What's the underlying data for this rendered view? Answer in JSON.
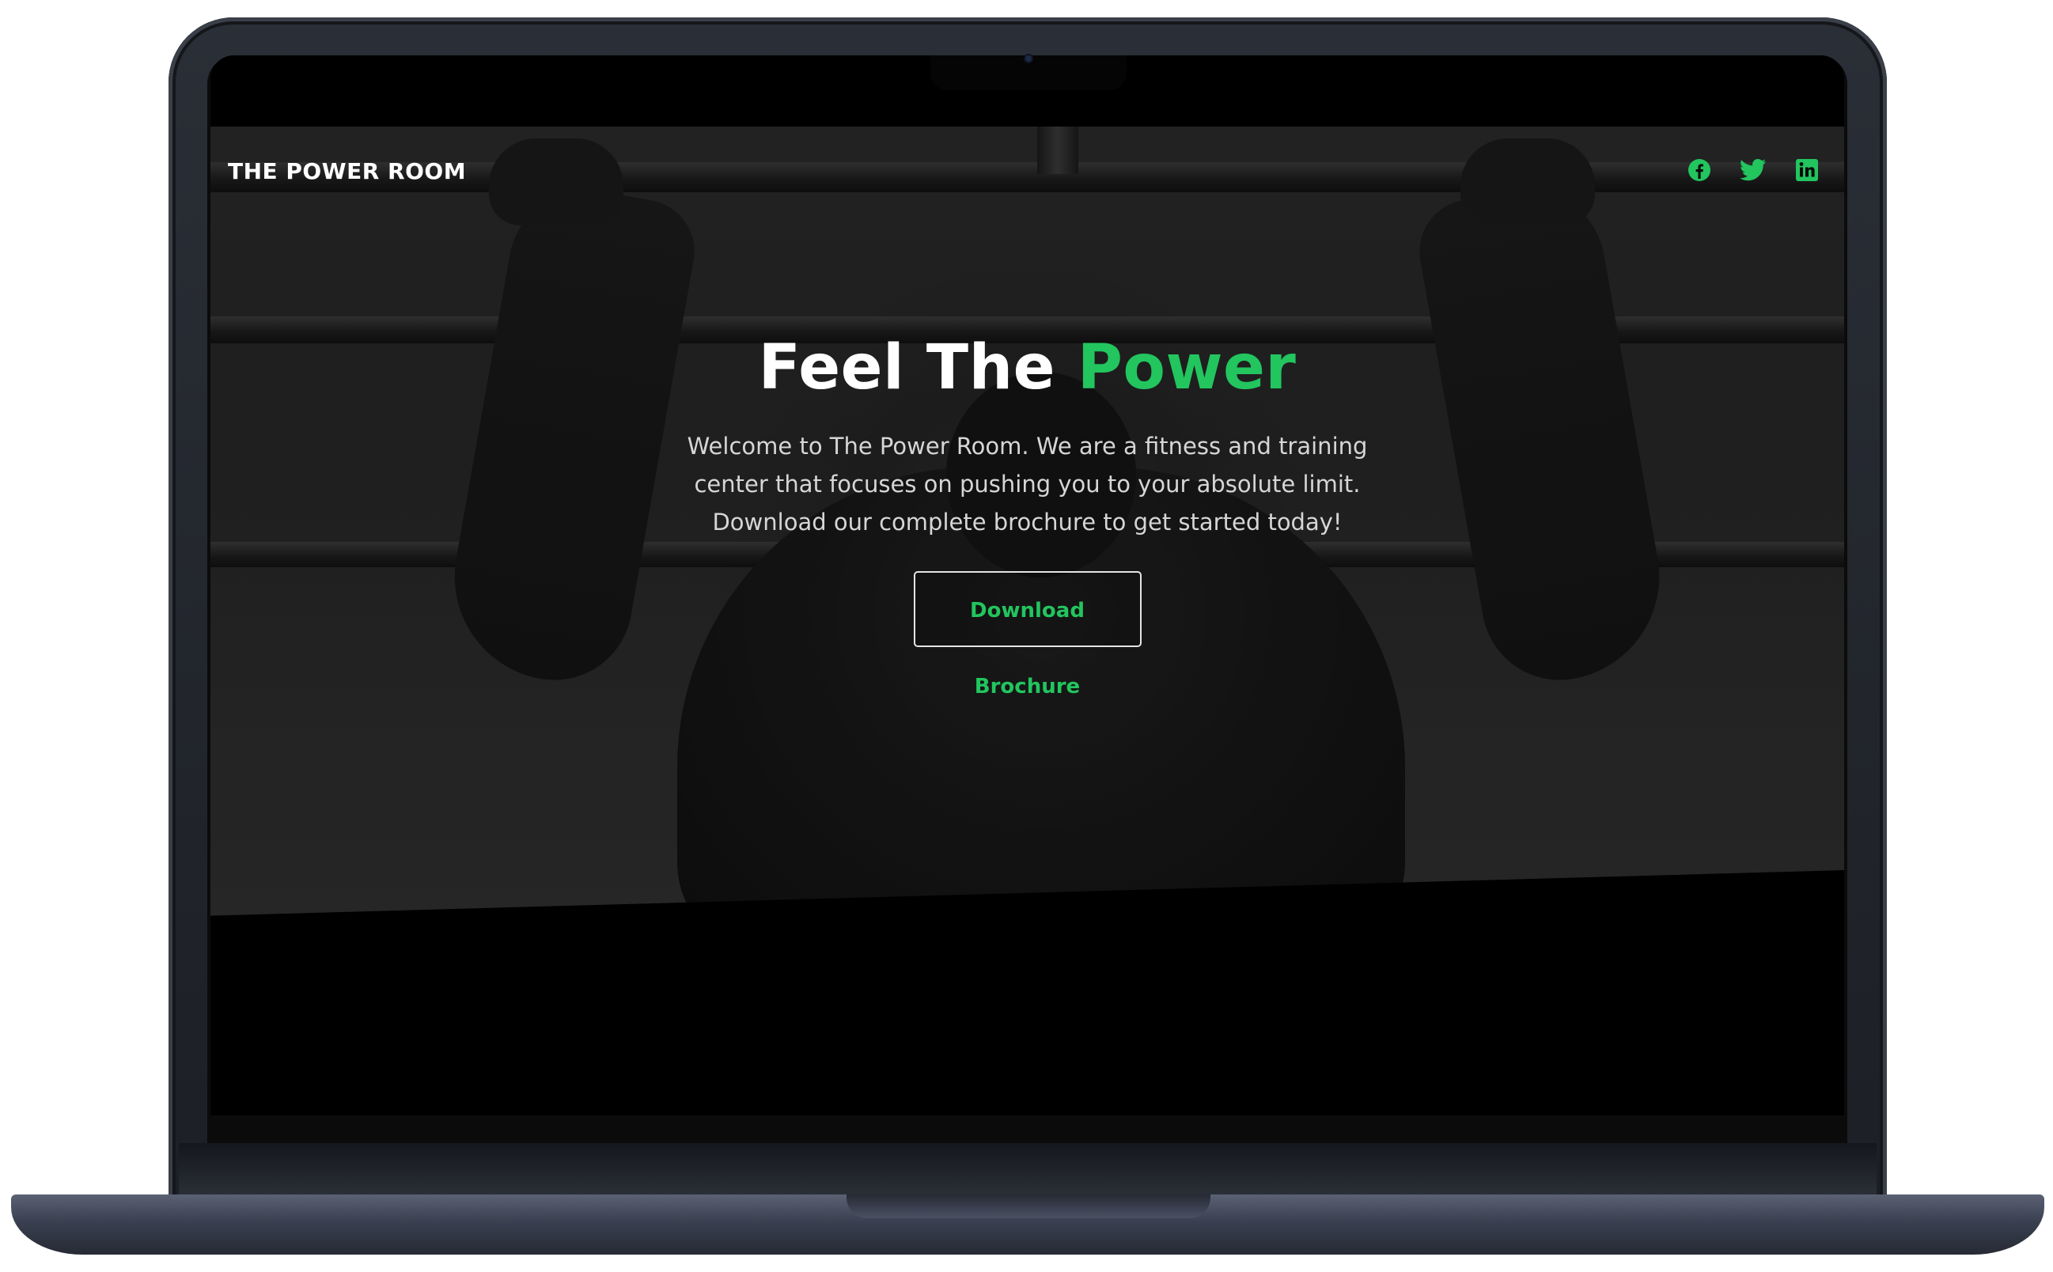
{
  "site": {
    "brand": "THE POWER ROOM",
    "accent_color": "#22c55e"
  },
  "nav": {
    "socials": [
      {
        "name": "facebook",
        "icon": "facebook-icon"
      },
      {
        "name": "twitter",
        "icon": "twitter-icon"
      },
      {
        "name": "linkedin",
        "icon": "linkedin-icon"
      }
    ]
  },
  "hero": {
    "title_main": "Feel The ",
    "title_accent": "Power",
    "description": "Welcome to The Power Room. We are a fitness and training center that focuses on pushing you to your absolute limit. Download our complete brochure to get started today!",
    "cta_label": "Download Brochure"
  }
}
